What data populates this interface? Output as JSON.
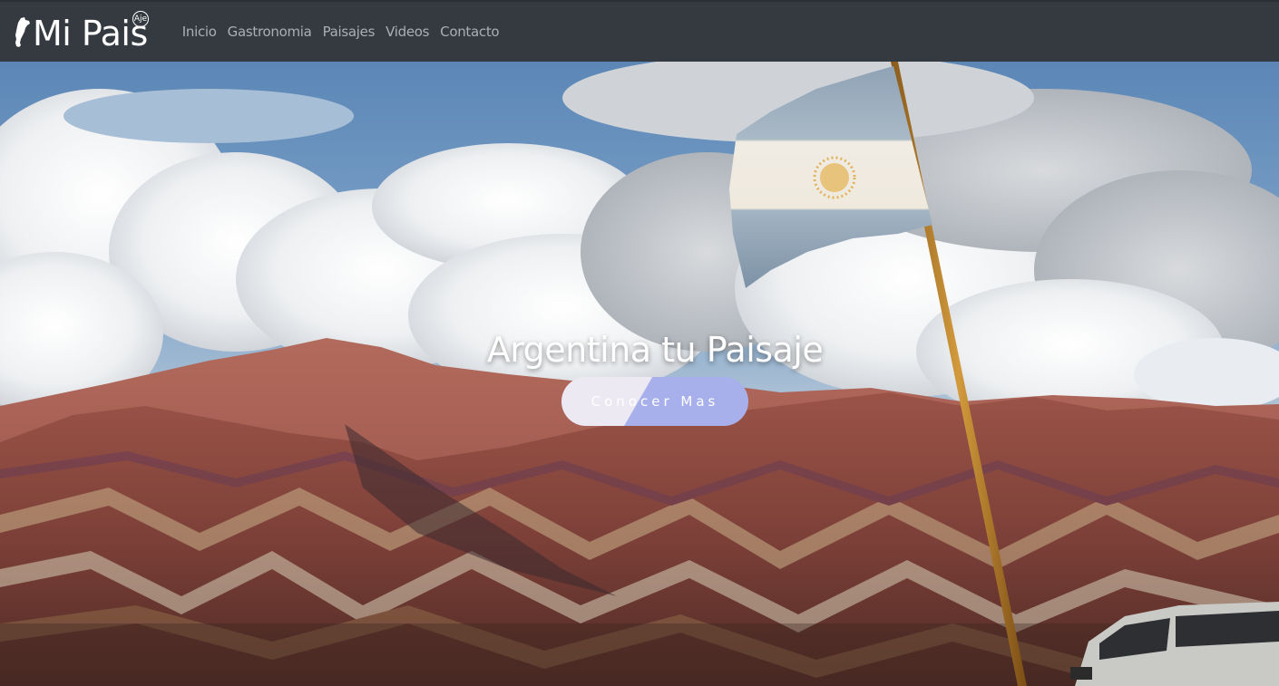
{
  "brand": {
    "name": "Mi Pais",
    "badge": "Aje"
  },
  "nav": {
    "items": [
      {
        "label": "Inicio"
      },
      {
        "label": "Gastronomia"
      },
      {
        "label": "Paisajes"
      },
      {
        "label": "Videos"
      },
      {
        "label": "Contacto"
      }
    ]
  },
  "hero": {
    "title": "Argentina tu Paisaje",
    "button_label": "Conocer Mas"
  },
  "colors": {
    "navbar": "#343a40",
    "nav_link": "#a9afb6",
    "button_light": "#ece9f3",
    "button_accent": "#a7b0ea"
  }
}
